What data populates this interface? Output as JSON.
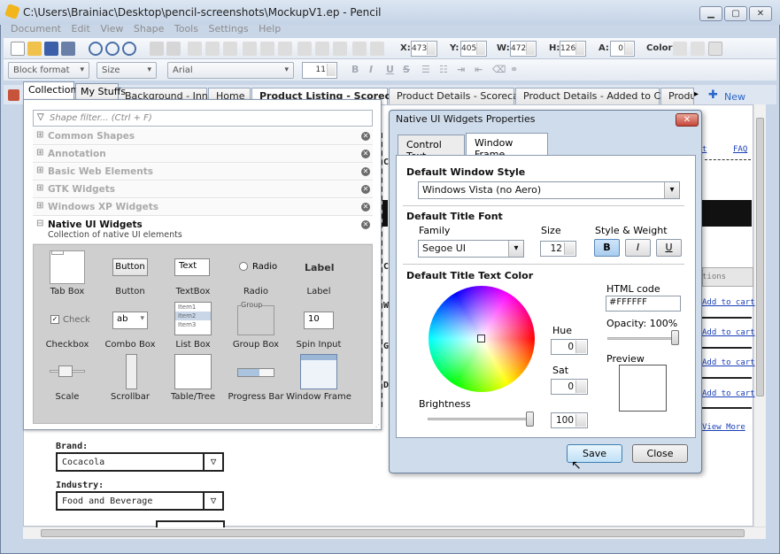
{
  "window": {
    "title": "C:\\Users\\Brainiac\\Desktop\\pencil-screenshots\\MockupV1.ep - Pencil"
  },
  "menu": [
    "Document",
    "Edit",
    "View",
    "Shape",
    "Tools",
    "Settings",
    "Help"
  ],
  "toolbar": {
    "x_label": "X:",
    "x_value": "473",
    "y_label": "Y:",
    "y_value": "405",
    "w_label": "W:",
    "w_value": "472",
    "h_label": "H:",
    "h_value": "126",
    "a_label": "A:",
    "a_value": "0",
    "color_label": "Color:"
  },
  "format_bar": {
    "block_format": "Block format",
    "size": "Size",
    "font": "Arial",
    "font_size": "11"
  },
  "page_tabs": [
    "Background - Inner",
    "Home",
    "Product Listing - Scorecards",
    "Product Details - Scorecard",
    "Product Details - Added to Cart",
    "Produ"
  ],
  "new_page": "New Page...",
  "panel": {
    "tabs": [
      "Collections",
      "My Stuffs"
    ],
    "filter_placeholder": "Shape filter... (Ctrl + F)",
    "collections": [
      "Common Shapes",
      "Annotation",
      "Basic Web Elements",
      "GTK Widgets",
      "Windows XP Widgets"
    ],
    "active_collection": {
      "name": "Native UI Widgets",
      "description": "Collection of native UI elements"
    },
    "widgets": [
      {
        "label": "Tab Box"
      },
      {
        "label": "Button",
        "preview": "Button"
      },
      {
        "label": "TextBox",
        "preview": "Text"
      },
      {
        "label": "Radio",
        "preview": "Radio"
      },
      {
        "label": "Label",
        "preview": "Label"
      },
      {
        "label": "Checkbox",
        "preview": "Check"
      },
      {
        "label": "Combo Box",
        "preview": "ab"
      },
      {
        "label": "List Box",
        "items": [
          "Item1",
          "Item2",
          "Item3"
        ]
      },
      {
        "label": "Group Box",
        "preview": "Group"
      },
      {
        "label": "Spin Input",
        "preview": "10"
      },
      {
        "label": "Scale"
      },
      {
        "label": "Scrollbar"
      },
      {
        "label": "Table/Tree"
      },
      {
        "label": "Progress Bar"
      },
      {
        "label": "Window Frame"
      }
    ]
  },
  "canvas": {
    "links": [
      "FAQ",
      "Add to cart",
      "Add to cart",
      "Add to cart",
      "Add to cart",
      "View More"
    ],
    "left_rows": [
      "C",
      "C",
      "W",
      "G",
      "D"
    ],
    "brand_label": "Brand:",
    "brand_value": "Cocacola",
    "industry_label": "Industry:",
    "industry_value": "Food and Beverage",
    "options_label": "tions"
  },
  "dialog": {
    "title": "Native UI Widgets Properties",
    "tabs": [
      "Control Text",
      "Window Frame"
    ],
    "window_style_heading": "Default Window Style",
    "window_style_value": "Windows Vista (no Aero)",
    "title_font_heading": "Default Title Font",
    "family_label": "Family",
    "family_value": "Segoe UI",
    "size_label": "Size",
    "size_value": "12",
    "style_label": "Style & Weight",
    "style_buttons": [
      "B",
      "I",
      "U"
    ],
    "color_heading": "Default Title Text Color",
    "hue_label": "Hue",
    "hue_value": "0",
    "sat_label": "Sat",
    "sat_value": "0",
    "brightness_label": "Brightness",
    "brightness_value": "100",
    "html_code_label": "HTML code",
    "html_code_value": "#FFFFFF",
    "opacity_label": "Opacity: 100%",
    "preview_label": "Preview",
    "save": "Save",
    "close": "Close",
    "preview_color": "#FFFFFF"
  }
}
